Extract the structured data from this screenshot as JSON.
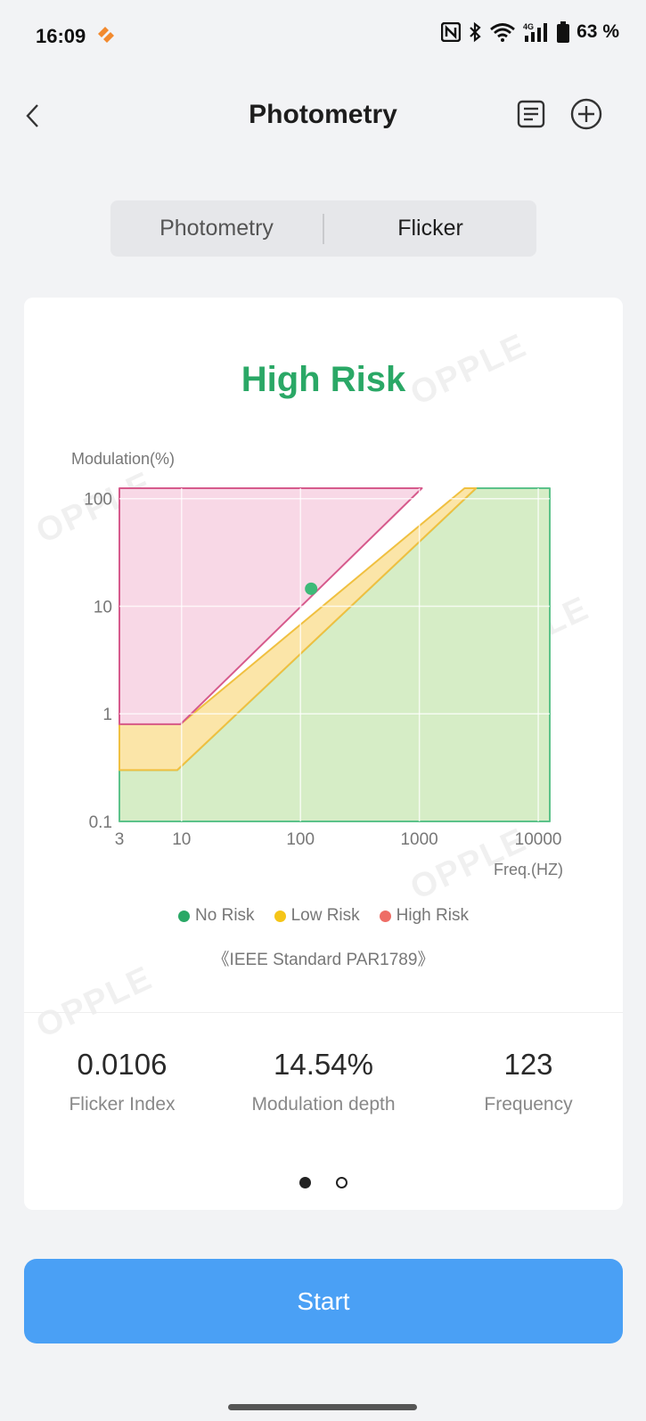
{
  "status_bar": {
    "time": "16:09",
    "battery": "63 %"
  },
  "header": {
    "title": "Photometry"
  },
  "tabs": [
    {
      "label": "Photometry",
      "active": false
    },
    {
      "label": "Flicker",
      "active": true
    }
  ],
  "card": {
    "risk_title": "High Risk",
    "watermark": "OPPLE",
    "standard": "《IEEE Standard PAR1789》",
    "legend": [
      {
        "label": "No Risk",
        "color": "#2aa866"
      },
      {
        "label": "Low Risk",
        "color": "#f5c518"
      },
      {
        "label": "High Risk",
        "color": "#ee6d66"
      }
    ],
    "metrics": [
      {
        "value": "0.0106",
        "label": "Flicker Index"
      },
      {
        "value": "14.54%",
        "label": "Modulation depth"
      },
      {
        "value": "123",
        "label": "Frequency"
      }
    ],
    "page_indicator": {
      "current": 1,
      "total": 2
    }
  },
  "chart_data": {
    "type": "area",
    "xlabel": "Freq.(HZ)",
    "ylabel": "Modulation(%)",
    "x_scale": "log",
    "y_scale": "log",
    "x_ticks": [
      "3",
      "10",
      "100",
      "1000",
      "10000"
    ],
    "y_ticks": [
      "0.1",
      "1",
      "10",
      "100"
    ],
    "xlim": [
      3,
      12500
    ],
    "ylim": [
      0.1,
      125
    ],
    "grid": true,
    "regions": [
      {
        "name": "No Risk",
        "color": "#d6edc6",
        "stroke": "#5cc28a",
        "points": [
          [
            3,
            0.1
          ],
          [
            3,
            0.3
          ],
          [
            9.2,
            0.3
          ],
          [
            3000,
            125
          ],
          [
            12500,
            125
          ],
          [
            12500,
            0.1
          ]
        ]
      },
      {
        "name": "Low Risk",
        "color": "#fbe5a8",
        "stroke": "#f0c040",
        "points": [
          [
            3,
            0.3
          ],
          [
            3,
            0.8
          ],
          [
            9.8,
            0.8
          ],
          [
            2400,
            125
          ],
          [
            3000,
            125
          ],
          [
            9.2,
            0.3
          ]
        ]
      },
      {
        "name": "High Risk",
        "color": "#f8d8e6",
        "stroke": "#d65a8c",
        "points": [
          [
            3,
            0.8
          ],
          [
            3,
            125
          ],
          [
            1050,
            125
          ],
          [
            9.8,
            0.8
          ]
        ]
      }
    ],
    "measurement": {
      "x": 123,
      "y": 14.54,
      "color": "#2aa866"
    }
  },
  "buttons": {
    "start": "Start"
  }
}
